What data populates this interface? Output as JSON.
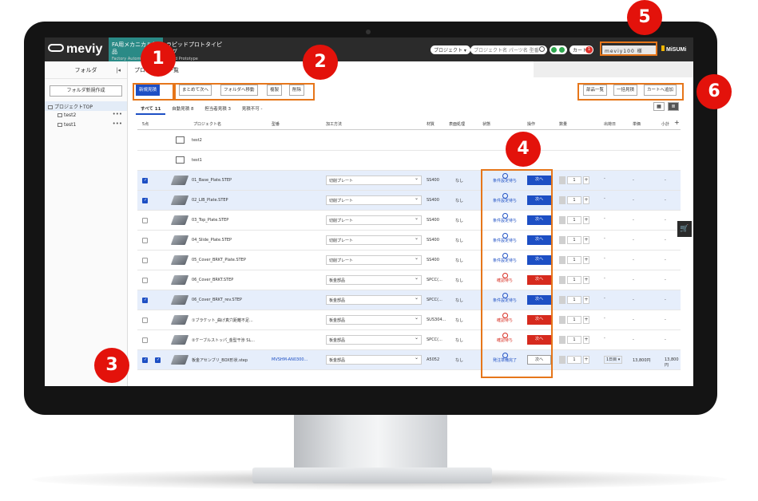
{
  "topbar": {
    "logo": "meviy",
    "tab1_title": "FA用メカニカル部品",
    "tab1_sub": "Factory Automation",
    "tab2_title": "ラピッドプロトタイピング",
    "tab2_sub": "Rapid Prototype",
    "project_select": "プロジェクト ▾",
    "search_placeholder": "プロジェクト名 パーツ名 型番",
    "cart_label": "カート",
    "cart_count": "1",
    "user_label": "meviy100 様",
    "brand": "MiSUMi"
  },
  "sidebar": {
    "header": "フォルダ",
    "collapse": "|◂",
    "new_folder": "フォルダ新規作成",
    "root": "プロジェクトTOP",
    "items": [
      {
        "label": "test2",
        "menu": "•••"
      },
      {
        "label": "test1",
        "menu": "•••"
      }
    ]
  },
  "main": {
    "breadcrumb": "プロジェクト一覧",
    "toolbar": {
      "new_quote": "新規見積",
      "bulk_next": "まとめて次へ",
      "move_folder": "フォルダへ移動",
      "copy": "複製",
      "delete": "削除",
      "parts_list": "部品一覧",
      "bulk_quote": "一括見積",
      "add_cart": "カートへ追加"
    },
    "subtabs": [
      {
        "label": "すべて 11",
        "active": true
      },
      {
        "label": "自動見積 8",
        "active": false
      },
      {
        "label": "担当者見積 3",
        "active": false
      },
      {
        "label": "見積不可 -",
        "active": false
      }
    ],
    "view_grid": "▦",
    "view_list": "≣",
    "columns": {
      "select": "5点",
      "name": "プロジェクト名",
      "part_no": "型番",
      "method": "加工方法",
      "material": "材質",
      "surface": "表面処理",
      "status": "状態",
      "operation": "操作",
      "quantity": "数量",
      "ship": "出荷日",
      "unit": "単価",
      "subtotal": "小計",
      "add": "+"
    },
    "folders": [
      "test2",
      "test1"
    ],
    "rows": [
      {
        "checked": true,
        "name": "01_Base_Plate.STEP",
        "method": "切削プレート",
        "material": "SS400",
        "surface": "なし",
        "status": "条件設定待ち",
        "color": "blue",
        "op": "次へ",
        "op_style": "blue",
        "qty": "1",
        "ship": "-",
        "unit": "-",
        "sub": "-"
      },
      {
        "checked": true,
        "name": "02_LIB_Plate.STEP",
        "method": "切削プレート",
        "material": "SS400",
        "surface": "なし",
        "status": "条件設定待ち",
        "color": "blue",
        "op": "次へ",
        "op_style": "blue",
        "qty": "1",
        "ship": "-",
        "unit": "-",
        "sub": "-"
      },
      {
        "checked": false,
        "name": "03_Top_Plate.STEP",
        "method": "切削プレート",
        "material": "SS400",
        "surface": "なし",
        "status": "条件設定待ち",
        "color": "blue",
        "op": "次へ",
        "op_style": "blue",
        "qty": "1",
        "ship": "-",
        "unit": "-",
        "sub": "-"
      },
      {
        "checked": false,
        "name": "04_Slide_Plate.STEP",
        "method": "切削プレート",
        "material": "SS400",
        "surface": "なし",
        "status": "条件設定待ち",
        "color": "blue",
        "op": "次へ",
        "op_style": "blue",
        "qty": "1",
        "ship": "-",
        "unit": "-",
        "sub": "-"
      },
      {
        "checked": false,
        "name": "05_Cover_BRKT_Plate.STEP",
        "method": "切削プレート",
        "material": "SS400",
        "surface": "なし",
        "status": "条件設定待ち",
        "color": "blue",
        "op": "次へ",
        "op_style": "blue",
        "qty": "1",
        "ship": "-",
        "unit": "-",
        "sub": "-"
      },
      {
        "checked": false,
        "name": "06_Cover_BRKT.STEP",
        "method": "板金部品",
        "material": "SPCC(...",
        "surface": "なし",
        "status": "確認待ち",
        "color": "red",
        "op": "次へ",
        "op_style": "red",
        "qty": "1",
        "ship": "-",
        "unit": "-",
        "sub": "-"
      },
      {
        "checked": true,
        "name": "06_Cover_BRKT_rev.STEP",
        "method": "板金部品",
        "material": "SPCC(...",
        "surface": "なし",
        "status": "条件設定待ち",
        "color": "blue",
        "op": "次へ",
        "op_style": "blue",
        "qty": "1",
        "ship": "-",
        "unit": "-",
        "sub": "-"
      },
      {
        "checked": false,
        "name": "①ブラケット_曲げ真穴距離不足...",
        "method": "板金部品",
        "material": "SUS304...",
        "surface": "なし",
        "status": "確認待ち",
        "color": "red",
        "op": "次へ",
        "op_style": "red",
        "qty": "1",
        "ship": "-",
        "unit": "-",
        "sub": "-"
      },
      {
        "checked": false,
        "name": "②ケーブルストッパ_金型干渉 SL...",
        "method": "板金部品",
        "material": "SPCC(...",
        "surface": "なし",
        "status": "確認待ち",
        "color": "red",
        "op": "次へ",
        "op_style": "red",
        "qty": "1",
        "ship": "-",
        "unit": "-",
        "sub": "-"
      },
      {
        "checked": true,
        "name": "板金アセンブリ_BOX形状.step",
        "part_no": "MVSHM-AN0300...",
        "method": "板金部品",
        "material": "A5052",
        "surface": "なし",
        "status": "発注準備完了",
        "color": "blue",
        "op": "次へ",
        "op_style": "white",
        "qty": "1",
        "ship": "1日目 ▾",
        "unit": "13,800円",
        "sub": "13,800円"
      }
    ],
    "side_cart": "🛒"
  },
  "annotations": [
    "1",
    "2",
    "3",
    "4",
    "5",
    "6"
  ]
}
